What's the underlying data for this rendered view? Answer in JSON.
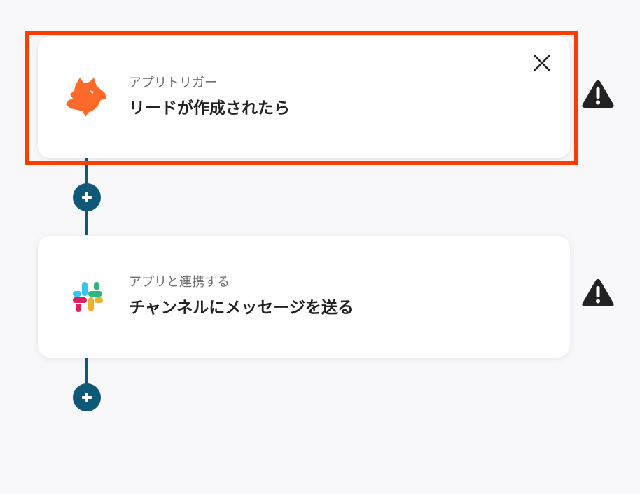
{
  "flow": {
    "steps": [
      {
        "subtitle": "アプリトリガー",
        "title": "リードが作成されたら",
        "icon": "fox-icon",
        "selected": true
      },
      {
        "subtitle": "アプリと連携する",
        "title": "チャンネルにメッセージを送る",
        "icon": "slack-icon",
        "selected": false
      }
    ],
    "colors": {
      "connector": "#0f5878",
      "selection": "#ff3c00",
      "fox": "#ff6a2b",
      "warning": "#222222"
    }
  }
}
